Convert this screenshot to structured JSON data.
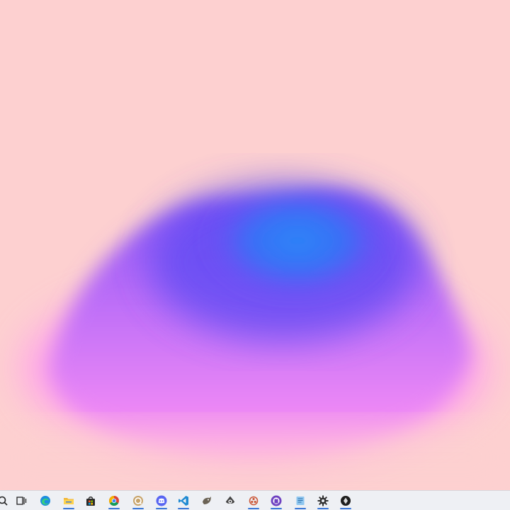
{
  "desktop": {
    "background_color": "#fdd0d0",
    "wallpaper": {
      "name": "gradient-blob",
      "colors": {
        "pink": "#ff8ff6",
        "violet": "#8a55f5",
        "indigo": "#5a48f3",
        "blue": "#2a7ff7"
      }
    }
  },
  "taskbar": {
    "background_color": "#eef0f4",
    "accent_color": "#3b78d8",
    "items": [
      {
        "icon": "search-icon",
        "running": false
      },
      {
        "icon": "task-view-icon",
        "running": false
      },
      {
        "icon": "edge-browser-icon",
        "running": false
      },
      {
        "icon": "file-explorer-icon",
        "running": true
      },
      {
        "icon": "microsoft-store-icon",
        "running": false
      },
      {
        "icon": "chrome-browser-icon",
        "running": true
      },
      {
        "icon": "qbittorrent-icon",
        "running": true
      },
      {
        "icon": "discord-icon",
        "running": true
      },
      {
        "icon": "vscode-icon",
        "running": true
      },
      {
        "icon": "gimp-icon",
        "running": false
      },
      {
        "icon": "inkscape-icon",
        "running": false
      },
      {
        "icon": "obs-icon",
        "running": true
      },
      {
        "icon": "github-desktop-icon",
        "running": true
      },
      {
        "icon": "notepad-icon",
        "running": true
      },
      {
        "icon": "settings-gear-icon",
        "running": true
      },
      {
        "icon": "app-circle-icon",
        "running": true
      }
    ]
  }
}
